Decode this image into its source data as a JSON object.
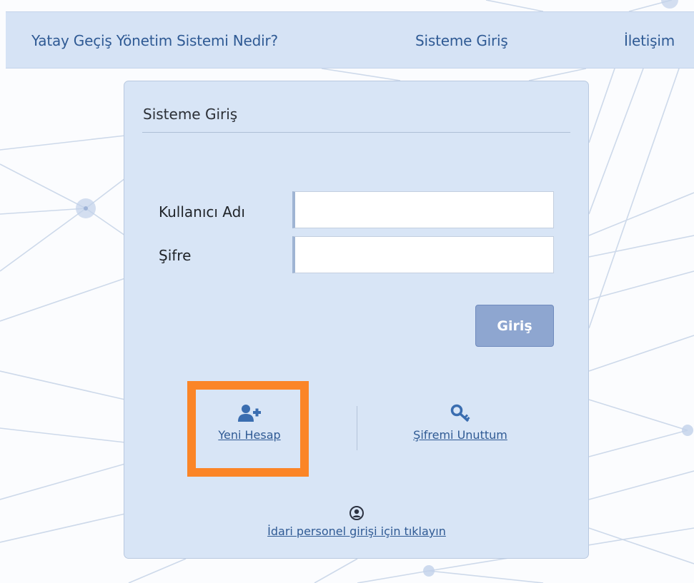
{
  "nav": {
    "items": [
      "Yatay Geçiş Yönetim Sistemi Nedir?",
      "Sisteme Giriş",
      "İletişim"
    ]
  },
  "login": {
    "title": "Sisteme Giriş",
    "username_label": "Kullanıcı Adı",
    "username_value": "",
    "password_label": "Şifre",
    "password_value": "",
    "submit_label": "Giriş"
  },
  "actions": {
    "new_account": "Yeni Hesap",
    "forgot_password": "Şifremi Unuttum",
    "admin_login": "İdari personel girişi için tıklayın"
  },
  "icons": {
    "new_account": "user-plus-icon",
    "forgot_password": "key-icon",
    "admin_login": "user-circle-icon"
  },
  "colors": {
    "nav_bg": "#d6e3f5",
    "panel_bg": "#d8e5f6",
    "link": "#2f5a94",
    "button": "#8ea6d0",
    "highlight": "#fb8527"
  }
}
